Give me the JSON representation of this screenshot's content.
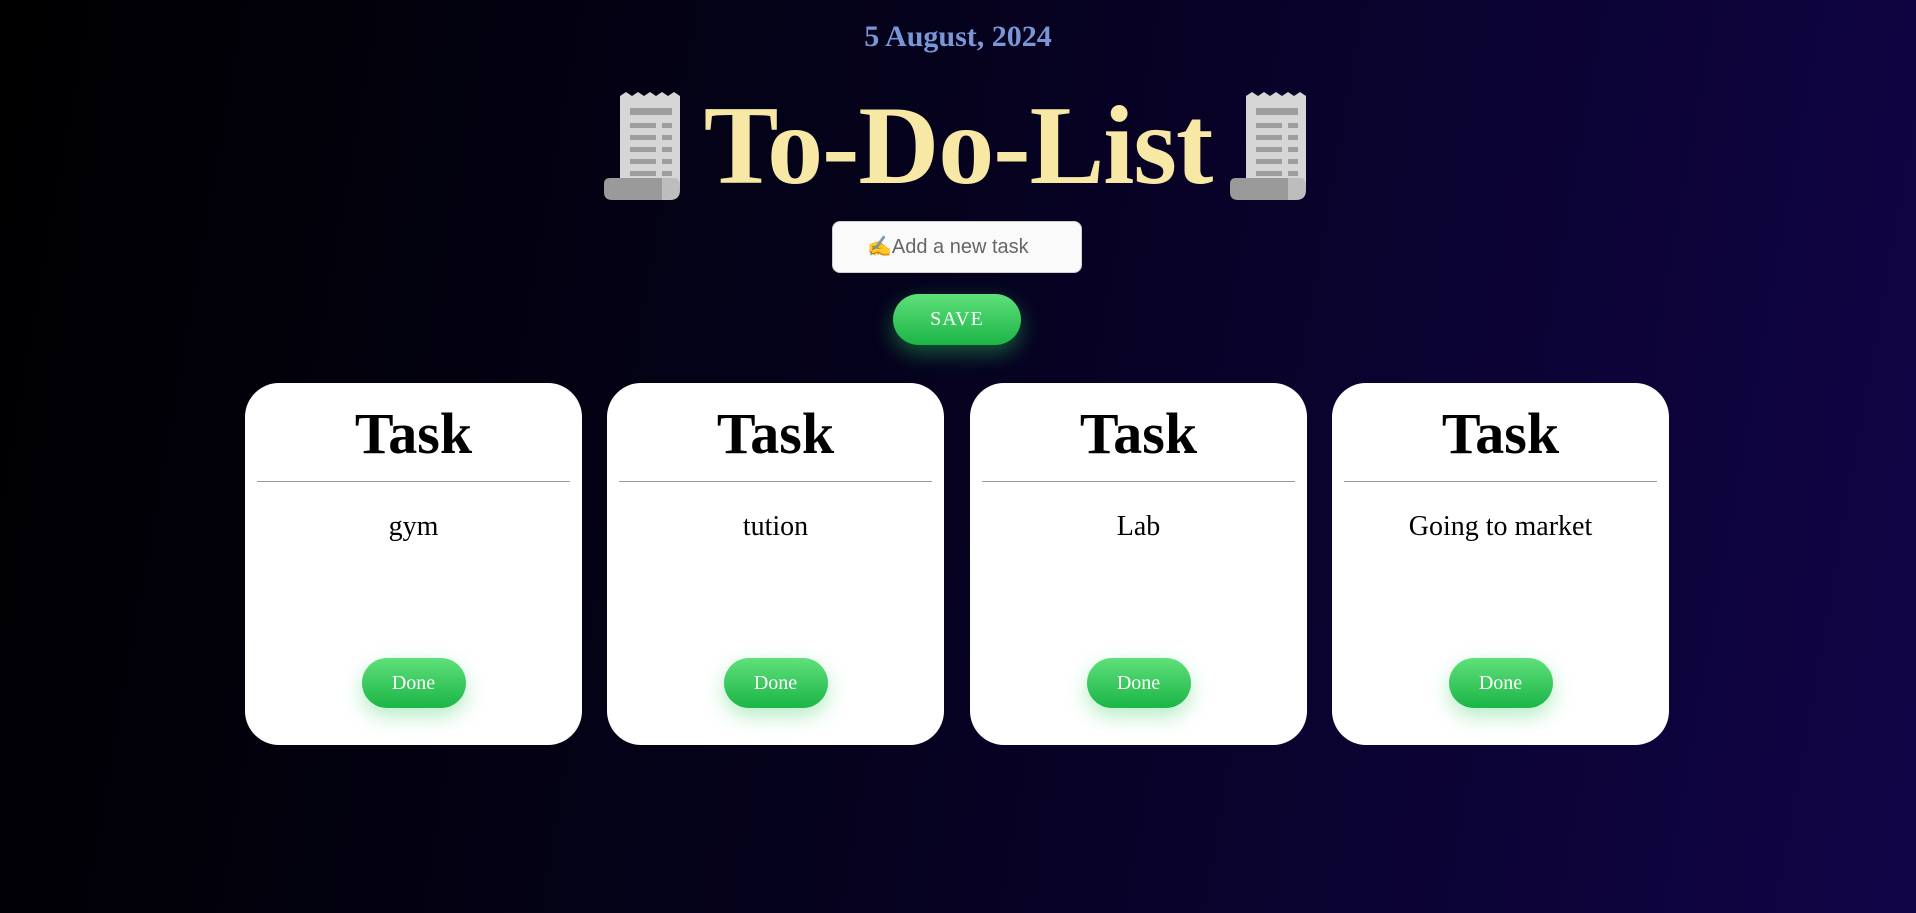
{
  "header": {
    "date": "5 August, 2024",
    "title": "To-Do-List",
    "title_icon": "receipt-icon"
  },
  "form": {
    "placeholder": "✍️Add a new task",
    "save_label": "SAVE"
  },
  "colors": {
    "title": "#f7e8a6",
    "date": "#7b96d6",
    "button_green": "#2ecc5a",
    "background_start": "#000000",
    "background_end": "#110447"
  },
  "tasks": [
    {
      "heading": "Task",
      "text": "gym",
      "button": "Done"
    },
    {
      "heading": "Task",
      "text": "tution",
      "button": "Done"
    },
    {
      "heading": "Task",
      "text": "Lab",
      "button": "Done"
    },
    {
      "heading": "Task",
      "text": "Going to market",
      "button": "Done"
    }
  ]
}
